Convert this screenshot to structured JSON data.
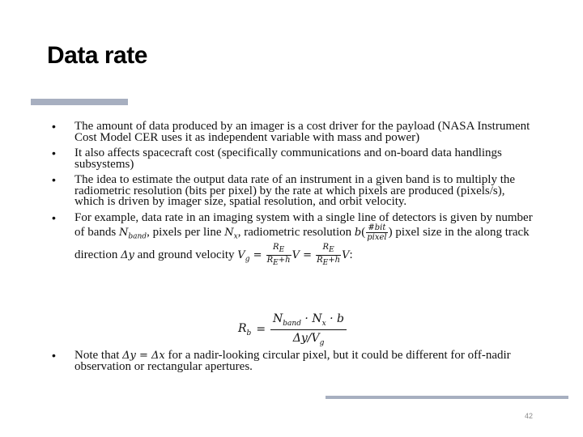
{
  "title": "Data rate",
  "slide_number": "42",
  "bullets": {
    "b1": "The amount of data produced by an imager is a cost driver for the payload (NASA Instrument Cost Model CER uses it as independent variable with mass and power)",
    "b2": "It also affects spacecraft cost (specifically communications and on-board data handlings subsystems)",
    "b3": "The idea to estimate the output data rate of an instrument in a given band is to multiply the radiometric resolution (bits per pixel) by the rate at which pixels are produced (pixels/s), which is driven by imager size, spatial resolution, and orbit velocity.",
    "b4_pre": "For example, data rate in an imaging system with a single line of detectors is given by number of bands ",
    "b4_mid1": ", pixels per line ",
    "b4_mid2": ", radiometric resolution ",
    "b4_mid3": " pixel size in the along track direction ",
    "b4_mid4": " and ground velocity ",
    "b4_end": ":",
    "b5_pre": "Note that ",
    "b5_post": " for a nadir-looking circular pixel, but it could be different for off-nadir observation or rectangular apertures."
  },
  "math": {
    "nband": "N",
    "nband_sub": "band",
    "nx": "N",
    "nx_sub": "x",
    "b": "b",
    "bit_num": "#bit",
    "bit_den": "pixel",
    "dy": "Δy",
    "vg": "V",
    "vg_sub": "g",
    "re": "R",
    "re_sub": "E",
    "re_h": "R",
    "re_h_sub": "E",
    "plus_h": "+h",
    "v": "V",
    "eq_lhs": "R",
    "eq_lhs_sub": "b",
    "eq_num": "N",
    "eq_num_sub": "band",
    "eq_num_rest1": " · N",
    "eq_num_rest1_sub": "x",
    "eq_num_rest2": " · b",
    "eq_den": "Δy/V",
    "eq_den_sub": "g",
    "note_eq": "Δy = Δx"
  }
}
